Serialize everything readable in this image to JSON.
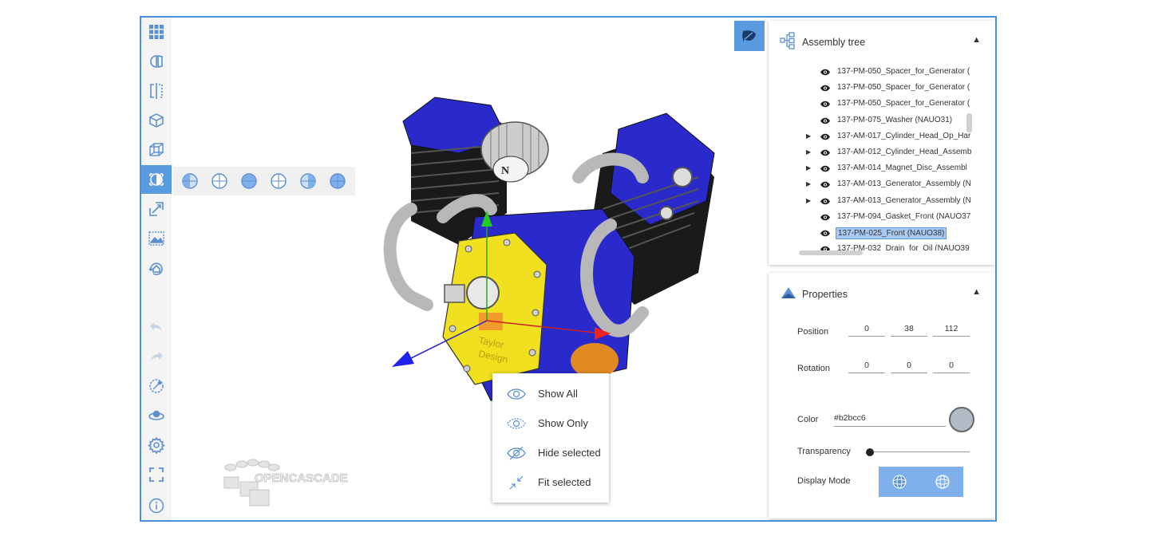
{
  "toolbar": {
    "buttons": [
      {
        "icon": "grid-apps-icon"
      },
      {
        "icon": "section-view-icon"
      },
      {
        "icon": "split-view-icon"
      },
      {
        "icon": "box-shaded-icon"
      },
      {
        "icon": "box-wireframe-icon"
      },
      {
        "icon": "view-orientation-icon",
        "active": true
      },
      {
        "icon": "explode-icon"
      },
      {
        "icon": "screenshot-icon"
      },
      {
        "icon": "home-view-icon"
      },
      {
        "icon": "undo-icon"
      },
      {
        "icon": "redo-icon"
      },
      {
        "icon": "measure-icon"
      },
      {
        "icon": "orbit-icon"
      },
      {
        "icon": "settings-icon"
      },
      {
        "icon": "fullscreen-icon"
      },
      {
        "icon": "info-icon"
      }
    ]
  },
  "view_flyout": [
    "view-left-icon",
    "view-front-icon",
    "view-top-icon",
    "view-iso-icon",
    "view-right-icon",
    "view-bottom-icon"
  ],
  "context_menu": {
    "show_all": "Show All",
    "show_only": "Show Only",
    "hide_selected": "Hide selected",
    "fit_selected": "Fit selected"
  },
  "logo": {
    "text": "OPENCASCADE"
  },
  "assembly_tree": {
    "title": "Assembly tree",
    "items": [
      {
        "label": "137-PM-050_Spacer_for_Generator (",
        "expandable": false,
        "selected": false
      },
      {
        "label": "137-PM-050_Spacer_for_Generator (",
        "expandable": false,
        "selected": false
      },
      {
        "label": "137-PM-050_Spacer_for_Generator (",
        "expandable": false,
        "selected": false
      },
      {
        "label": "137-PM-075_Washer (NAUO31)",
        "expandable": false,
        "selected": false
      },
      {
        "label": "137-AM-017_Cylinder_Head_Op_Har",
        "expandable": true,
        "selected": false
      },
      {
        "label": "137-AM-012_Cylinder_Head_Assemb",
        "expandable": true,
        "selected": false
      },
      {
        "label": "137-AM-014_Magnet_Disc_Assembl",
        "expandable": true,
        "selected": false
      },
      {
        "label": "137-AM-013_Generator_Assembly (N",
        "expandable": true,
        "selected": false
      },
      {
        "label": "137-AM-013_Generator_Assembly (N",
        "expandable": true,
        "selected": false
      },
      {
        "label": "137-PM-094_Gasket_Front (NAUO37",
        "expandable": false,
        "selected": false
      },
      {
        "label": "137-PM-025_Front (NAUO38)",
        "expandable": false,
        "selected": true
      },
      {
        "label": "137-PM-032_Drain_for_Oil (NAUO39",
        "expandable": false,
        "selected": false
      }
    ]
  },
  "properties": {
    "title": "Properties",
    "position_label": "Position",
    "position": [
      "0",
      "38",
      "112"
    ],
    "rotation_label": "Rotation",
    "rotation": [
      "0",
      "0",
      "0"
    ],
    "color_label": "Color",
    "color_value": "#b2bcc6",
    "transparency_label": "Transparency",
    "transparency": 0,
    "display_mode_label": "Display Mode"
  },
  "colors": {
    "accent": "#5a9be0",
    "engine_blue": "#2424c8",
    "part_yellow": "#f0e020",
    "selection": "#a9c9f2"
  }
}
